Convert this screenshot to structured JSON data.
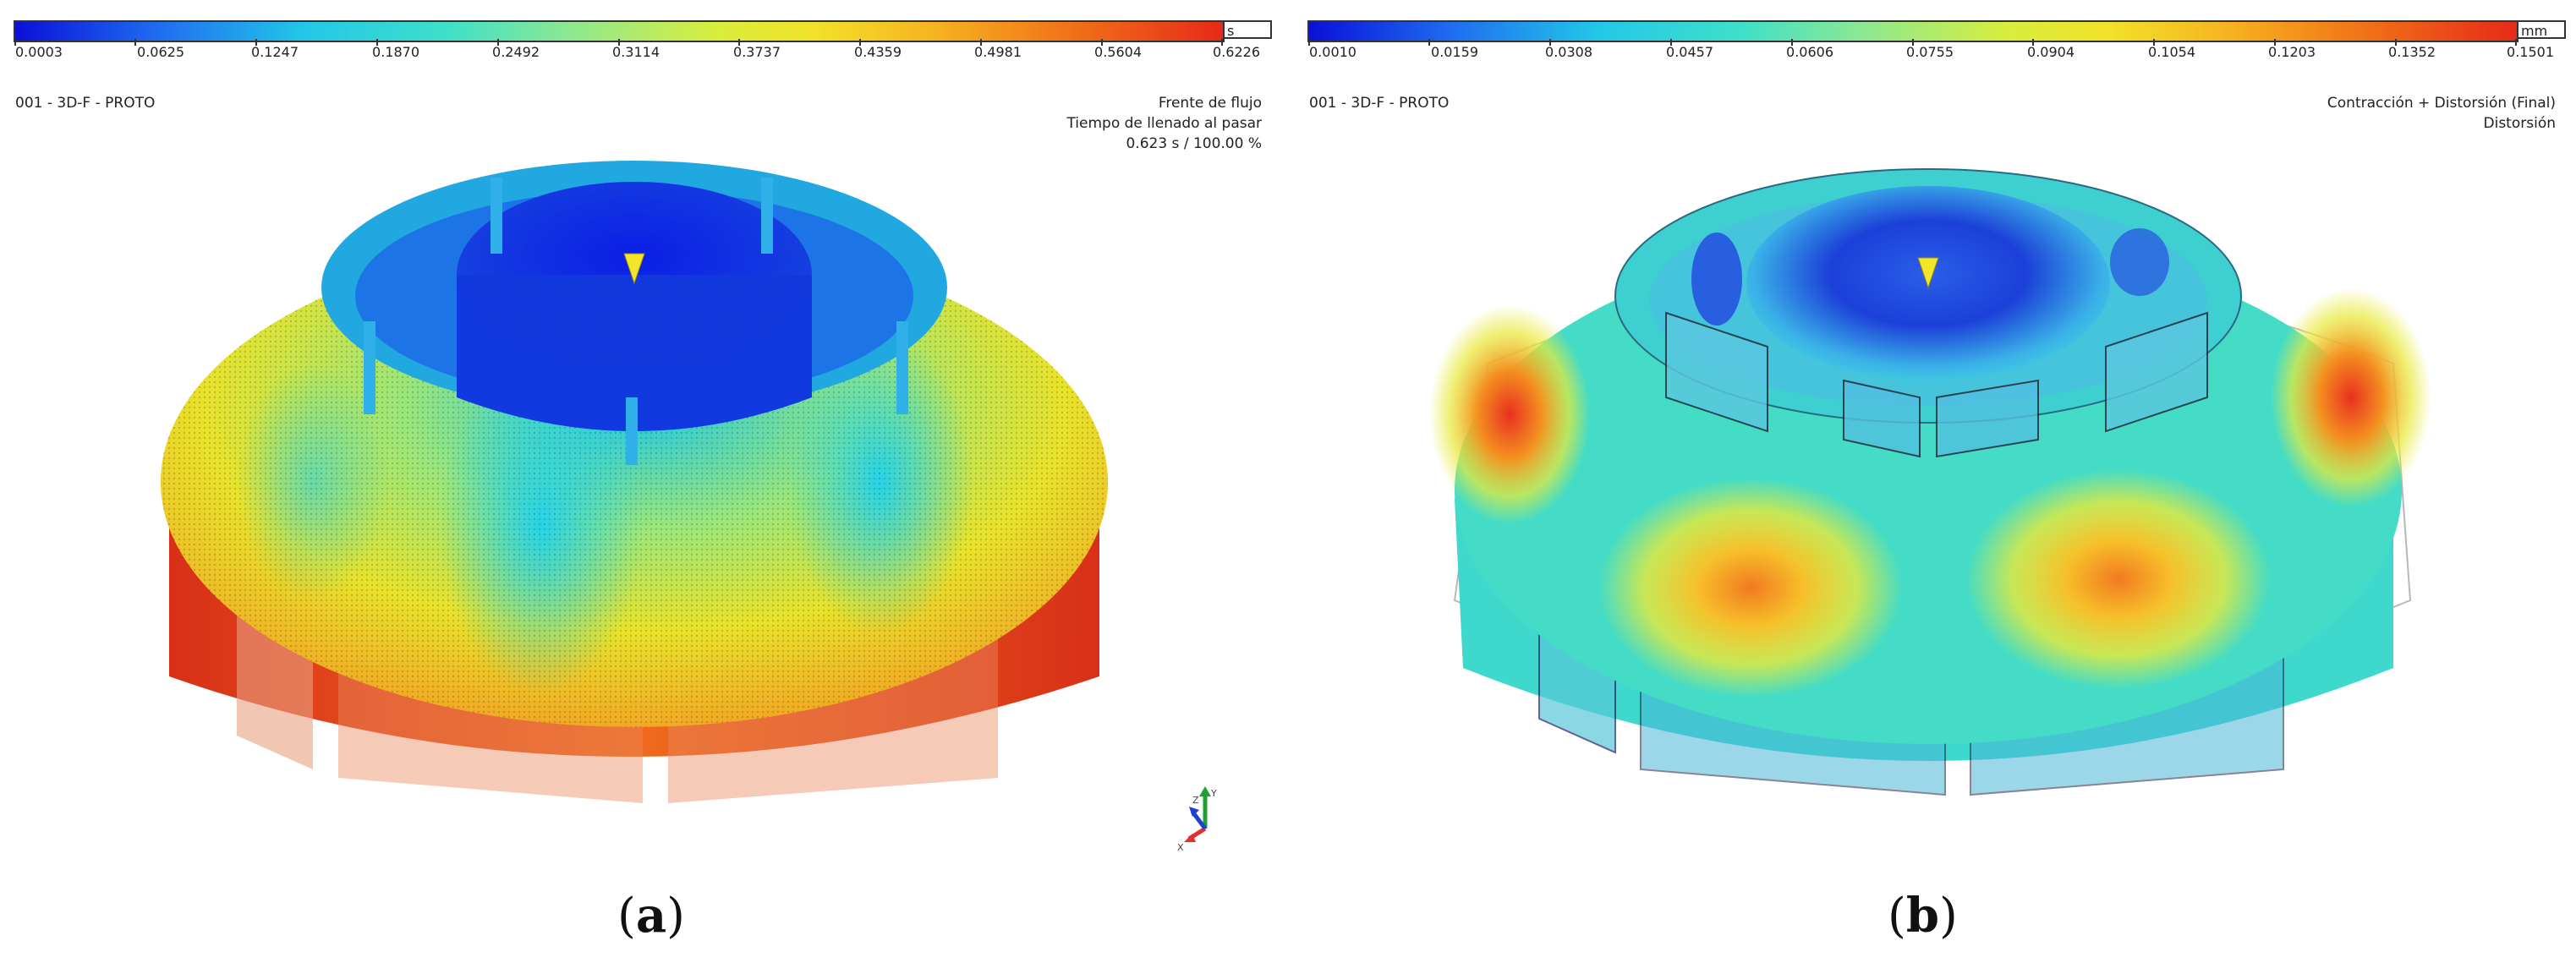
{
  "panels": [
    {
      "id": "a",
      "unit": "s",
      "ticks": [
        "0.0003",
        "0.0625",
        "0.1247",
        "0.1870",
        "0.2492",
        "0.3114",
        "0.3737",
        "0.4359",
        "0.4981",
        "0.5604",
        "0.6226"
      ],
      "study": "001 - 3D-F - PROTO",
      "info": [
        "Frente de flujo",
        "Tiempo de llenado al pasar",
        "0.623 s  /  100.00 %"
      ],
      "axis_labels": [
        "Z",
        "Y",
        "X"
      ],
      "caption_letter": "a"
    },
    {
      "id": "b",
      "unit": "mm",
      "ticks": [
        "0.0010",
        "0.0159",
        "0.0308",
        "0.0457",
        "0.0606",
        "0.0755",
        "0.0904",
        "0.1054",
        "0.1203",
        "0.1352",
        "0.1501"
      ],
      "study": "001 - 3D-F - PROTO",
      "info": [
        "Contracción + Distorsión (Final)",
        "Distorsión"
      ],
      "caption_letter": "b"
    }
  ],
  "colors": {
    "scale": [
      "#0a10d8",
      "#1f6ef0",
      "#22c8e8",
      "#40e0c8",
      "#8ee890",
      "#d8ee3c",
      "#f2e22a",
      "#f6b420",
      "#f27a18",
      "#e62a18"
    ]
  }
}
